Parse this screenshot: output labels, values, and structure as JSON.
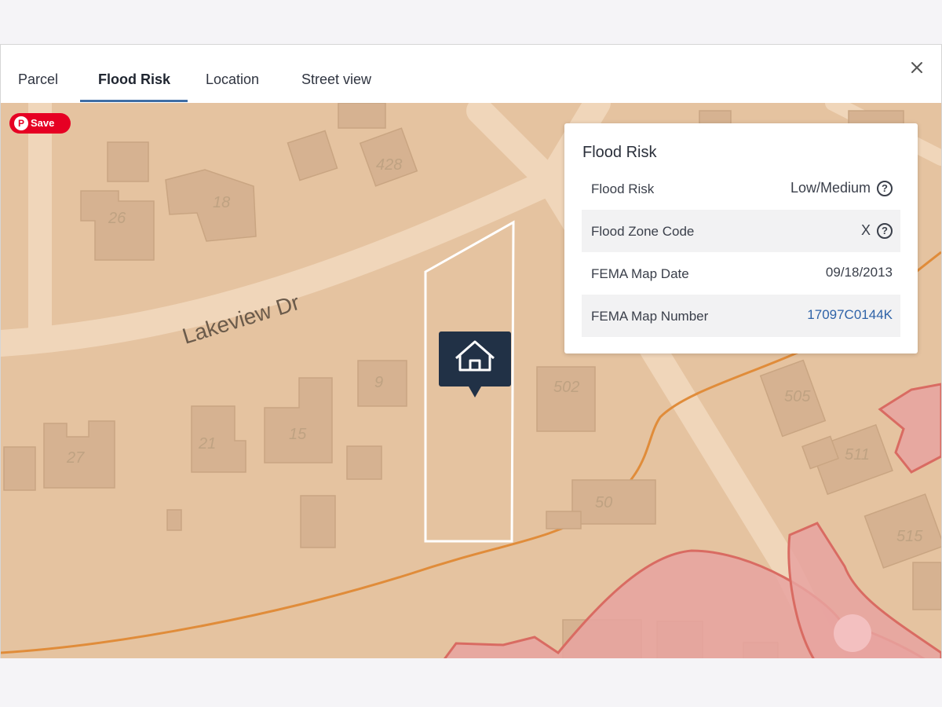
{
  "tabs": [
    {
      "label": "Parcel"
    },
    {
      "label": "Flood Risk",
      "active": true
    },
    {
      "label": "Location"
    },
    {
      "label": "Street view"
    }
  ],
  "close_icon": "close-icon",
  "save_button": {
    "label": "Save",
    "icon": "pinterest-icon",
    "color": "#e60023"
  },
  "map": {
    "street_label": "Lakeview Dr",
    "house_numbers": [
      "26",
      "18",
      "428",
      "27",
      "21",
      "15",
      "9",
      "502",
      "505",
      "511",
      "515",
      "50"
    ],
    "marker_icon": "home-icon",
    "colors": {
      "land": "#e5c3a0",
      "building": "#d6b291",
      "road": "#f0d6ba",
      "flood_zone": "#e8a3a0",
      "flood_edge": "#d96b62",
      "contour": "#e08c3a",
      "parcel_outline": "#ffffff"
    }
  },
  "flood_card": {
    "title": "Flood Risk",
    "rows": [
      {
        "label": "Flood Risk",
        "value": "Low/Medium",
        "help": true
      },
      {
        "label": "Flood Zone Code",
        "value": "X",
        "help": true
      },
      {
        "label": "FEMA Map Date",
        "value": "09/18/2013"
      },
      {
        "label": "FEMA Map Number",
        "value": "17097C0144K",
        "link": true
      }
    ]
  }
}
